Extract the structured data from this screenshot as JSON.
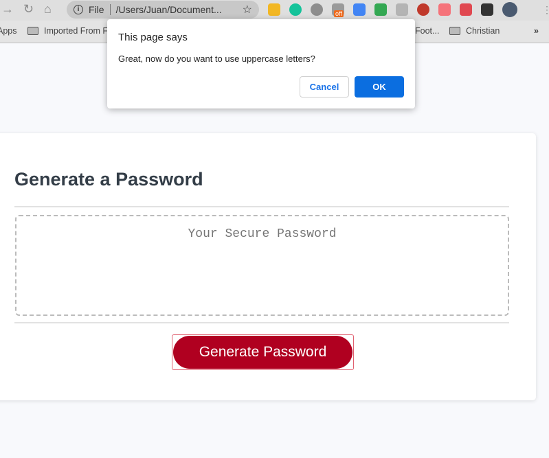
{
  "browser": {
    "address": {
      "scheme_label": "File",
      "url": "/Users/Juan/Document..."
    },
    "extensions": [
      {
        "name": "tasks-extension",
        "color": "#f2b724"
      },
      {
        "name": "grammarly-extension",
        "color": "#15c39a"
      },
      {
        "name": "circle-extension",
        "color": "#8d8d8d"
      },
      {
        "name": "ghost-extension",
        "color": "#9a9a9a",
        "badge": "off"
      },
      {
        "name": "translate-extension",
        "color": "#4285f4"
      },
      {
        "name": "drive-extension",
        "color": "#34a853"
      },
      {
        "name": "honey-extension",
        "color": "#b4b4b4"
      },
      {
        "name": "flag-extension",
        "color": "#c0392b"
      },
      {
        "name": "cast-extension",
        "color": "#f5737a"
      },
      {
        "name": "shield-extension",
        "color": "#e04850"
      },
      {
        "name": "puzzle-extension",
        "color": "#333333"
      },
      {
        "name": "profile-avatar",
        "color": "#4a5a70"
      }
    ],
    "bookmarks": [
      {
        "label": "Apps"
      },
      {
        "label": "Imported From F"
      },
      {
        "label": "Foot..."
      },
      {
        "label": "Christian"
      }
    ],
    "bookmarks_overflow": "»"
  },
  "page": {
    "title": "Generate a Password",
    "password_placeholder": "Your Secure Password",
    "generate_label": "Generate Password",
    "accent": "#b00020"
  },
  "dialog": {
    "title": "This page says",
    "message": "Great, now do you want to use uppercase letters?",
    "cancel_label": "Cancel",
    "ok_label": "OK"
  }
}
